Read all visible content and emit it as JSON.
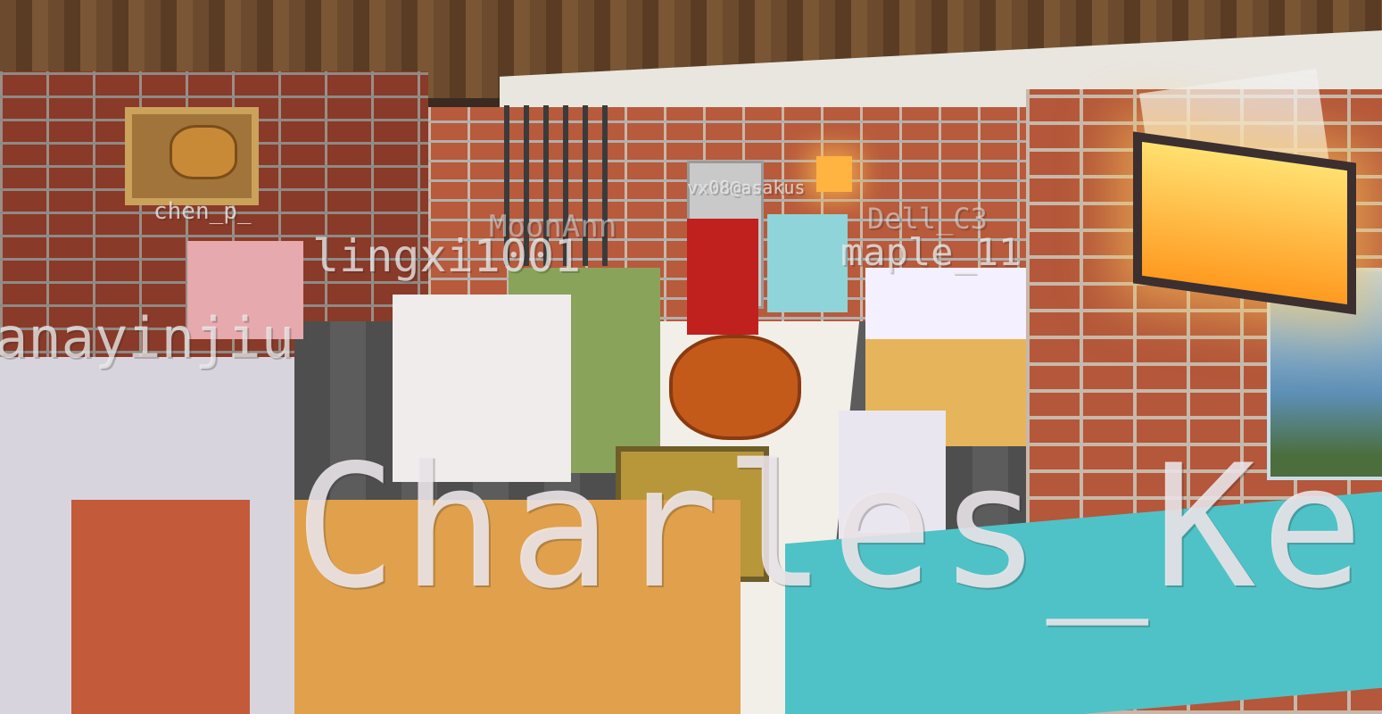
{
  "nametags": {
    "chen_p": "chen_p_",
    "moonann": "MoonAnn",
    "vx08": "vx08@asakus",
    "dell": "Dell_C3",
    "lingxi": "lingxi1001",
    "maple": "maple_11",
    "anayinjiu": "anayinjiu",
    "charles": "Charles_Ke"
  },
  "colors": {
    "brick": "#b85a3c",
    "ceiling_wood": "#6b4a2e",
    "nametag_text": "#ebebeb",
    "lantern_glow": "#ffb340"
  },
  "icons": [
    "bread-icon",
    "lantern-icon"
  ]
}
